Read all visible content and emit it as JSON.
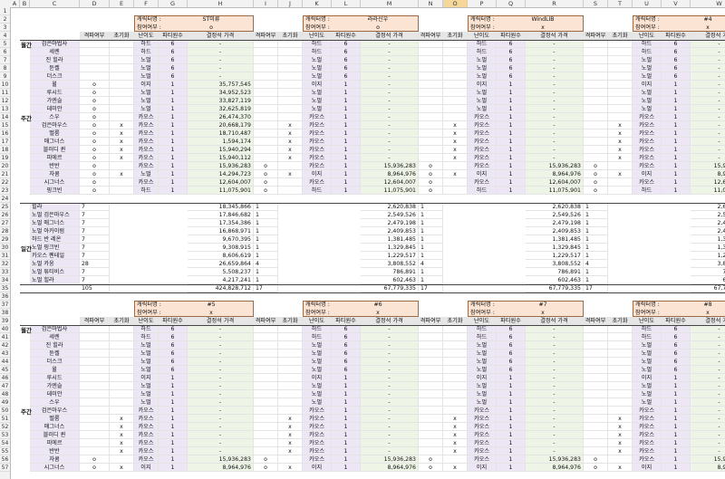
{
  "column_headers": [
    "A",
    "B",
    "C",
    "D",
    "E",
    "F",
    "G",
    "H",
    "I",
    "J",
    "K",
    "L",
    "M",
    "N",
    "O",
    "P",
    "Q",
    "R",
    "S",
    "T",
    "U",
    "V",
    "W",
    "X"
  ],
  "selected_column": "O",
  "row_numbers": [
    "1",
    "2",
    "3",
    "4",
    "5",
    "6",
    "7",
    "8",
    "9",
    "10",
    "11",
    "12",
    "13",
    "14",
    "15",
    "16",
    "17",
    "18",
    "19",
    "20",
    "21",
    "22",
    "23",
    "24",
    "25",
    "26",
    "27",
    "28",
    "29",
    "30",
    "31",
    "32",
    "33",
    "34",
    "35",
    "36",
    "37",
    "38",
    "39",
    "40",
    "41",
    "42",
    "43",
    "44",
    "45",
    "46",
    "47",
    "48",
    "49",
    "50",
    "51",
    "52",
    "53",
    "54",
    "55",
    "56",
    "57"
  ],
  "labels": {
    "char_name": "캐릭터명 :",
    "participation": "참여여부 :"
  },
  "headers": {
    "clear": "격파여부",
    "reset": "초기화",
    "difficulty": "난이도",
    "party": "파티원수",
    "price": "결정석 가격"
  },
  "section_labels": {
    "daily": "일간",
    "weekly": "주간",
    "monthly": "월간"
  },
  "block1": {
    "characters": [
      {
        "name": "ST미류",
        "participation": "o"
      },
      {
        "name": "라라신우",
        "participation": "o"
      },
      {
        "name": "WindLIB",
        "participation": "x"
      },
      {
        "name": "#4",
        "participation": "x"
      }
    ],
    "bosses": [
      "검은마법사",
      "세렌",
      "진 힐라",
      "듄켈",
      "더스크",
      "윌",
      "루시드",
      "가엔슬",
      "데미안",
      "스우",
      "검은마우스",
      "벨룸",
      "매그너스",
      "블러디 퀸",
      "피에르",
      "반반",
      "자쿰",
      "시그너스",
      "핑크빈",
      "힐라",
      "노멀 검은마우스",
      "노멀 매그너스",
      "노멀 아카이럼",
      "하드 반 레온",
      "노멀 핑크빈",
      "카오스 펜테일",
      "노멀 카웅",
      "노멀 튜티비스",
      "노멀 힐라",
      "노멀 자쿰"
    ],
    "rows": [
      {
        "c1": "",
        "r1": "",
        "d": "하드",
        "p": "6",
        "v": "-",
        "c2": "",
        "r2": "",
        "d2": "하드",
        "p2": "6",
        "v2": "-",
        "c3": "",
        "r3": "",
        "d3": "하드",
        "p3": "6",
        "v3": "-",
        "c4": "",
        "r4": "",
        "d4": "하드",
        "p4": "6",
        "v4": "-"
      },
      {
        "c1": "",
        "r1": "",
        "d": "하드",
        "p": "6",
        "v": "-",
        "c2": "",
        "r2": "",
        "d2": "하드",
        "p2": "6",
        "v2": "-",
        "c3": "",
        "r3": "",
        "d3": "하드",
        "p3": "6",
        "v3": "-",
        "c4": "",
        "r4": "",
        "d4": "하드",
        "p4": "6",
        "v4": "-"
      },
      {
        "c1": "",
        "r1": "",
        "d": "노멀",
        "p": "6",
        "v": "-",
        "c2": "",
        "r2": "",
        "d2": "노멀",
        "p2": "6",
        "v2": "-",
        "c3": "",
        "r3": "",
        "d3": "노멀",
        "p3": "6",
        "v3": "-",
        "c4": "",
        "r4": "",
        "d4": "노멀",
        "p4": "6",
        "v4": "-"
      },
      {
        "c1": "",
        "r1": "",
        "d": "노멀",
        "p": "6",
        "v": "-",
        "c2": "",
        "r2": "",
        "d2": "노멀",
        "p2": "6",
        "v2": "-",
        "c3": "",
        "r3": "",
        "d3": "노멀",
        "p3": "6",
        "v3": "-",
        "c4": "",
        "r4": "",
        "d4": "노멀",
        "p4": "6",
        "v4": "-"
      },
      {
        "c1": "",
        "r1": "",
        "d": "노멀",
        "p": "6",
        "v": "-",
        "c2": "",
        "r2": "",
        "d2": "노멀",
        "p2": "6",
        "v2": "-",
        "c3": "",
        "r3": "",
        "d3": "노멀",
        "p3": "6",
        "v3": "-",
        "c4": "",
        "r4": "",
        "d4": "노멀",
        "p4": "6",
        "v4": "-"
      },
      {
        "c1": "o",
        "r1": "",
        "d": "이지",
        "p": "1",
        "v": "35,757,545",
        "c2": "",
        "r2": "",
        "d2": "이지",
        "p2": "1",
        "v2": "-",
        "c3": "",
        "r3": "",
        "d3": "이지",
        "p3": "1",
        "v3": "-",
        "c4": "",
        "r4": "",
        "d4": "이지",
        "p4": "1",
        "v4": "-"
      },
      {
        "c1": "o",
        "r1": "",
        "d": "노멀",
        "p": "1",
        "v": "34,952,523",
        "c2": "",
        "r2": "",
        "d2": "노멀",
        "p2": "1",
        "v2": "-",
        "c3": "",
        "r3": "",
        "d3": "노멀",
        "p3": "1",
        "v3": "-",
        "c4": "",
        "r4": "",
        "d4": "노멀",
        "p4": "1",
        "v4": "-"
      },
      {
        "c1": "o",
        "r1": "",
        "d": "노멀",
        "p": "1",
        "v": "33,827,119",
        "c2": "",
        "r2": "",
        "d2": "노멀",
        "p2": "1",
        "v2": "-",
        "c3": "",
        "r3": "",
        "d3": "노멀",
        "p3": "1",
        "v3": "-",
        "c4": "",
        "r4": "",
        "d4": "노멀",
        "p4": "1",
        "v4": "-"
      },
      {
        "c1": "o",
        "r1": "",
        "d": "노멀",
        "p": "1",
        "v": "32,625,819",
        "c2": "",
        "r2": "",
        "d2": "노멀",
        "p2": "1",
        "v2": "-",
        "c3": "",
        "r3": "",
        "d3": "노멀",
        "p3": "1",
        "v3": "-",
        "c4": "",
        "r4": "",
        "d4": "노멀",
        "p4": "1",
        "v4": "-"
      },
      {
        "c1": "o",
        "r1": "",
        "d": "카오스",
        "p": "1",
        "v": "26,474,370",
        "c2": "",
        "r2": "",
        "d2": "카오스",
        "p2": "1",
        "v2": "-",
        "c3": "",
        "r3": "",
        "d3": "카오스",
        "p3": "1",
        "v3": "-",
        "c4": "",
        "r4": "",
        "d4": "카오스",
        "p4": "1",
        "v4": "-"
      },
      {
        "c1": "o",
        "r1": "x",
        "d": "카오스",
        "p": "1",
        "v": "20,668,179",
        "c2": "",
        "r2": "x",
        "d2": "카오스",
        "p2": "1",
        "v2": "-",
        "c3": "",
        "r3": "x",
        "d3": "카오스",
        "p3": "1",
        "v3": "-",
        "c4": "",
        "r4": "x",
        "d4": "카오스",
        "p4": "1",
        "v4": "-"
      },
      {
        "c1": "o",
        "r1": "x",
        "d": "카오스",
        "p": "1",
        "v": "18,710,487",
        "c2": "",
        "r2": "x",
        "d2": "카오스",
        "p2": "1",
        "v2": "-",
        "c3": "",
        "r3": "x",
        "d3": "카오스",
        "p3": "1",
        "v3": "-",
        "c4": "",
        "r4": "x",
        "d4": "카오스",
        "p4": "1",
        "v4": "-"
      },
      {
        "c1": "o",
        "r1": "x",
        "d": "카오스",
        "p": "1",
        "v": "1,594,174",
        "c2": "",
        "r2": "x",
        "d2": "카오스",
        "p2": "1",
        "v2": "-",
        "c3": "",
        "r3": "x",
        "d3": "카오스",
        "p3": "1",
        "v3": "-",
        "c4": "",
        "r4": "x",
        "d4": "카오스",
        "p4": "1",
        "v4": "-"
      },
      {
        "c1": "o",
        "r1": "x",
        "d": "카오스",
        "p": "1",
        "v": "15,940,294",
        "c2": "",
        "r2": "x",
        "d2": "카오스",
        "p2": "1",
        "v2": "-",
        "c3": "",
        "r3": "x",
        "d3": "카오스",
        "p3": "1",
        "v3": "-",
        "c4": "",
        "r4": "x",
        "d4": "카오스",
        "p4": "1",
        "v4": "-"
      },
      {
        "c1": "o",
        "r1": "x",
        "d": "카오스",
        "p": "1",
        "v": "15,940,112",
        "c2": "",
        "r2": "x",
        "d2": "카오스",
        "p2": "1",
        "v2": "-",
        "c3": "",
        "r3": "x",
        "d3": "카오스",
        "p3": "1",
        "v3": "-",
        "c4": "",
        "r4": "x",
        "d4": "카오스",
        "p4": "1",
        "v4": "-"
      },
      {
        "c1": "o",
        "r1": "",
        "d": "카오스",
        "p": "1",
        "v": "15,936,283",
        "c2": "o",
        "r2": "",
        "d2": "카오스",
        "p2": "1",
        "v2": "15,936,283",
        "c3": "o",
        "r3": "",
        "d3": "카오스",
        "p3": "1",
        "v3": "15,936,283",
        "c4": "o",
        "r4": "",
        "d4": "카오스",
        "p4": "1",
        "v4": "15,936,283"
      },
      {
        "c1": "o",
        "r1": "x",
        "d": "노멀",
        "p": "1",
        "v": "14,294,723",
        "c2": "o",
        "r2": "x",
        "d2": "이지",
        "p2": "1",
        "v2": "8,964,976",
        "c3": "o",
        "r3": "x",
        "d3": "이지",
        "p3": "1",
        "v3": "8,964,976",
        "c4": "o",
        "r4": "x",
        "d4": "이지",
        "p4": "1",
        "v4": "8,964,976"
      },
      {
        "c1": "o",
        "r1": "",
        "d": "카오스",
        "p": "1",
        "v": "12,604,007",
        "c2": "o",
        "r2": "",
        "d2": "카오스",
        "p2": "1",
        "v2": "12,604,007",
        "c3": "o",
        "r3": "",
        "d3": "카오스",
        "p3": "1",
        "v3": "12,604,007",
        "c4": "o",
        "r4": "",
        "d4": "카오스",
        "p4": "1",
        "v4": "12,604,007"
      },
      {
        "c1": "o",
        "r1": "",
        "d": "하드",
        "p": "1",
        "v": "11,075,901",
        "c2": "o",
        "r2": "",
        "d2": "하드",
        "p2": "1",
        "v2": "11,075,901",
        "c3": "o",
        "r3": "",
        "d3": "하드",
        "p3": "1",
        "v3": "11,075,901",
        "c4": "o",
        "r4": "",
        "d4": "하드",
        "p4": "1",
        "v4": "11,075,901"
      }
    ],
    "daily_rows": [
      {
        "n1": "7",
        "v": "18,345,866",
        "n2": "1",
        "v2": "2,620,838",
        "n3": "1",
        "v3": "2,620,838",
        "n4": "1",
        "v4": "2,620,838"
      },
      {
        "n1": "7",
        "v": "17,846,682",
        "n2": "1",
        "v2": "2,549,526",
        "n3": "1",
        "v3": "2,549,526",
        "n4": "1",
        "v4": "2,549,526"
      },
      {
        "n1": "7",
        "v": "17,354,386",
        "n2": "1",
        "v2": "2,479,198",
        "n3": "1",
        "v3": "2,479,198",
        "n4": "1",
        "v4": "2,479,198"
      },
      {
        "n1": "7",
        "v": "16,868,971",
        "n2": "1",
        "v2": "2,409,853",
        "n3": "1",
        "v3": "2,409,853",
        "n4": "1",
        "v4": "2,409,853"
      },
      {
        "n1": "7",
        "v": "9,670,395",
        "n2": "1",
        "v2": "1,381,485",
        "n3": "1",
        "v3": "1,381,485",
        "n4": "1",
        "v4": "1,381,485"
      },
      {
        "n1": "7",
        "v": "9,308,915",
        "n2": "1",
        "v2": "1,329,845",
        "n3": "1",
        "v3": "1,329,845",
        "n4": "1",
        "v4": "1,329,845"
      },
      {
        "n1": "7",
        "v": "8,606,619",
        "n2": "1",
        "v2": "1,229,517",
        "n3": "1",
        "v3": "1,229,517",
        "n4": "1",
        "v4": "1,229,517"
      },
      {
        "n1": "28",
        "v": "26,659,864",
        "n2": "4",
        "v2": "3,808,552",
        "n3": "4",
        "v3": "3,808,552",
        "n4": "4",
        "v4": "3,808,552"
      },
      {
        "n1": "7",
        "v": "5,508,237",
        "n2": "1",
        "v2": "786,891",
        "n3": "1",
        "v3": "786,891",
        "n4": "1",
        "v4": "786,891"
      },
      {
        "n1": "7",
        "v": "4,217,241",
        "n2": "1",
        "v2": "602,463",
        "n3": "1",
        "v3": "602,463",
        "n4": "1",
        "v4": "602,463"
      }
    ],
    "totals": {
      "n1": "105",
      "v": "424,828,712",
      "n2": "17",
      "v2": "67,779,335",
      "n3": "17",
      "v3": "67,779,335",
      "n4": "17",
      "v4": "67,779,335"
    }
  },
  "block2": {
    "characters": [
      {
        "name": "#5",
        "participation": "x"
      },
      {
        "name": "#6",
        "participation": "x"
      },
      {
        "name": "#7",
        "participation": "x"
      },
      {
        "name": "#8",
        "participation": "x"
      }
    ],
    "bosses": [
      "검은마법사",
      "세렌",
      "진 힐라",
      "듄켈",
      "더스크",
      "윌",
      "루시드",
      "가엔슬",
      "데미안",
      "스우",
      "검은마우스",
      "벨룸",
      "매그너스",
      "블러디 퀸",
      "피에르",
      "반반",
      "자쿰",
      "시그너스"
    ],
    "rows": [
      {
        "c": "",
        "r": "",
        "d": "하드",
        "p": "6",
        "v": "-"
      },
      {
        "c": "",
        "r": "",
        "d": "하드",
        "p": "6",
        "v": "-"
      },
      {
        "c": "",
        "r": "",
        "d": "노멀",
        "p": "6",
        "v": "-"
      },
      {
        "c": "",
        "r": "",
        "d": "노멀",
        "p": "6",
        "v": "-"
      },
      {
        "c": "",
        "r": "",
        "d": "노멀",
        "p": "6",
        "v": "-"
      },
      {
        "c": "",
        "r": "",
        "d": "노멀",
        "p": "6",
        "v": "-"
      },
      {
        "c": "",
        "r": "",
        "d": "이지",
        "p": "1",
        "v": "-"
      },
      {
        "c": "",
        "r": "",
        "d": "노멀",
        "p": "1",
        "v": "-"
      },
      {
        "c": "",
        "r": "",
        "d": "노멀",
        "p": "1",
        "v": "-"
      },
      {
        "c": "",
        "r": "",
        "d": "노멀",
        "p": "1",
        "v": "-"
      },
      {
        "c": "",
        "r": "",
        "d": "카오스",
        "p": "1",
        "v": "-"
      },
      {
        "c": "",
        "r": "x",
        "d": "카오스",
        "p": "1",
        "v": "-"
      },
      {
        "c": "",
        "r": "x",
        "d": "카오스",
        "p": "1",
        "v": "-"
      },
      {
        "c": "",
        "r": "x",
        "d": "카오스",
        "p": "1",
        "v": "-"
      },
      {
        "c": "",
        "r": "x",
        "d": "카오스",
        "p": "1",
        "v": "-"
      },
      {
        "c": "",
        "r": "x",
        "d": "카오스",
        "p": "1",
        "v": "-"
      },
      {
        "c": "o",
        "r": "",
        "d": "카오스",
        "p": "1",
        "v": "15,936,283"
      },
      {
        "c": "o",
        "r": "x",
        "d": "이지",
        "p": "1",
        "v": "8,964,976"
      }
    ]
  }
}
